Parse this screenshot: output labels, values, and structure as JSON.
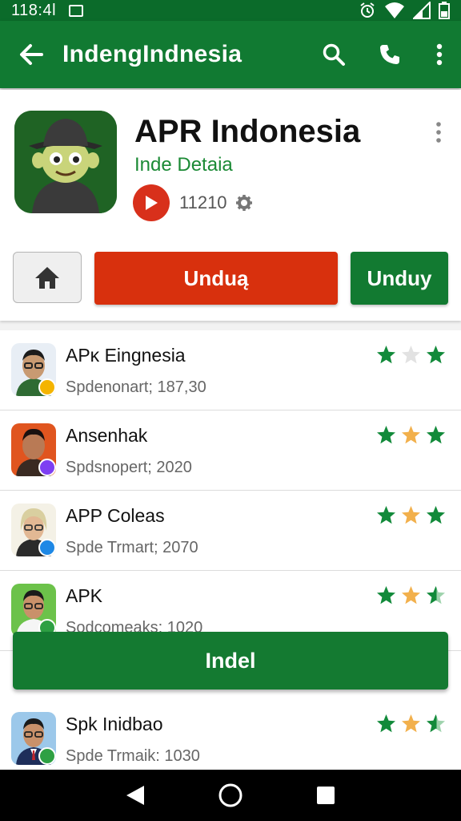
{
  "status_bar": {
    "time": "118:4l"
  },
  "app_bar": {
    "title": "IndengIndnesia"
  },
  "app": {
    "name": "APR Indonesia",
    "developer": "Inde Detaia",
    "count": "11210",
    "download_primary": "Unduą",
    "download_secondary": "Unduy"
  },
  "list": [
    {
      "name": "APᴋ Eingnesia",
      "sub": "Spdenonart; 187,30",
      "stars": [
        "green",
        "gray",
        "green"
      ],
      "badge": "#f4b400"
    },
    {
      "name": "Ansenhak",
      "sub": "Spdsnopert; 2020",
      "stars": [
        "green",
        "orange",
        "green"
      ],
      "badge": "#7e3ff2"
    },
    {
      "name": "APP Coleas",
      "sub": "Spde Trmart; 2070",
      "stars": [
        "green",
        "orange",
        "green"
      ],
      "badge": "#1e88e5"
    },
    {
      "name": "APK",
      "sub": "Sodcomeaks: 1020",
      "stars": [
        "green",
        "orange",
        "half"
      ],
      "badge": "#2ea043"
    },
    {
      "name": "Spk  Inidbao",
      "sub": "Spde Trmaik: 1030",
      "stars": [
        "green",
        "orange",
        "half"
      ],
      "badge": "#2ea043"
    }
  ],
  "install_label": "Indel",
  "colors": {
    "primary": "#117a32",
    "accent_red": "#d8300d",
    "star_green": "#128a3a",
    "star_orange": "#f2b04c"
  }
}
